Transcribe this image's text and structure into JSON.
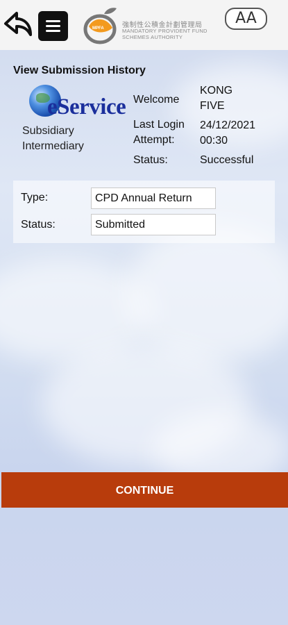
{
  "header": {
    "back_icon": "back-arrow-icon",
    "menu_icon": "hamburger-menu-icon",
    "logo": {
      "name_zh": "強制性公積金計劃管理局",
      "name_en_line1": "Mandatory Provident Fund",
      "name_en_line2": "Schemes Authority"
    },
    "font_size_button": "AA"
  },
  "page_title": "View Submission History",
  "eservice": {
    "logo_text": "eService",
    "role_line1": "Subsidiary",
    "role_line2": "Intermediary"
  },
  "user_info": {
    "welcome_label": "Welcome",
    "name_line1": "KONG",
    "name_line2": "FIVE",
    "last_login_label_line1": "Last Login",
    "last_login_label_line2": "Attempt:",
    "last_login_date": "24/12/2021",
    "last_login_time": "00:30",
    "status_label": "Status:",
    "status_value": "Successful"
  },
  "filters": {
    "type_label": "Type:",
    "type_value": "CPD Annual Return",
    "status_label": "Status:",
    "status_value": "Submitted"
  },
  "continue_button": "CONTINUE",
  "colors": {
    "accent": "#b83c0c",
    "eservice_blue": "#1b2f9c",
    "logo_orange": "#f39a1e"
  }
}
